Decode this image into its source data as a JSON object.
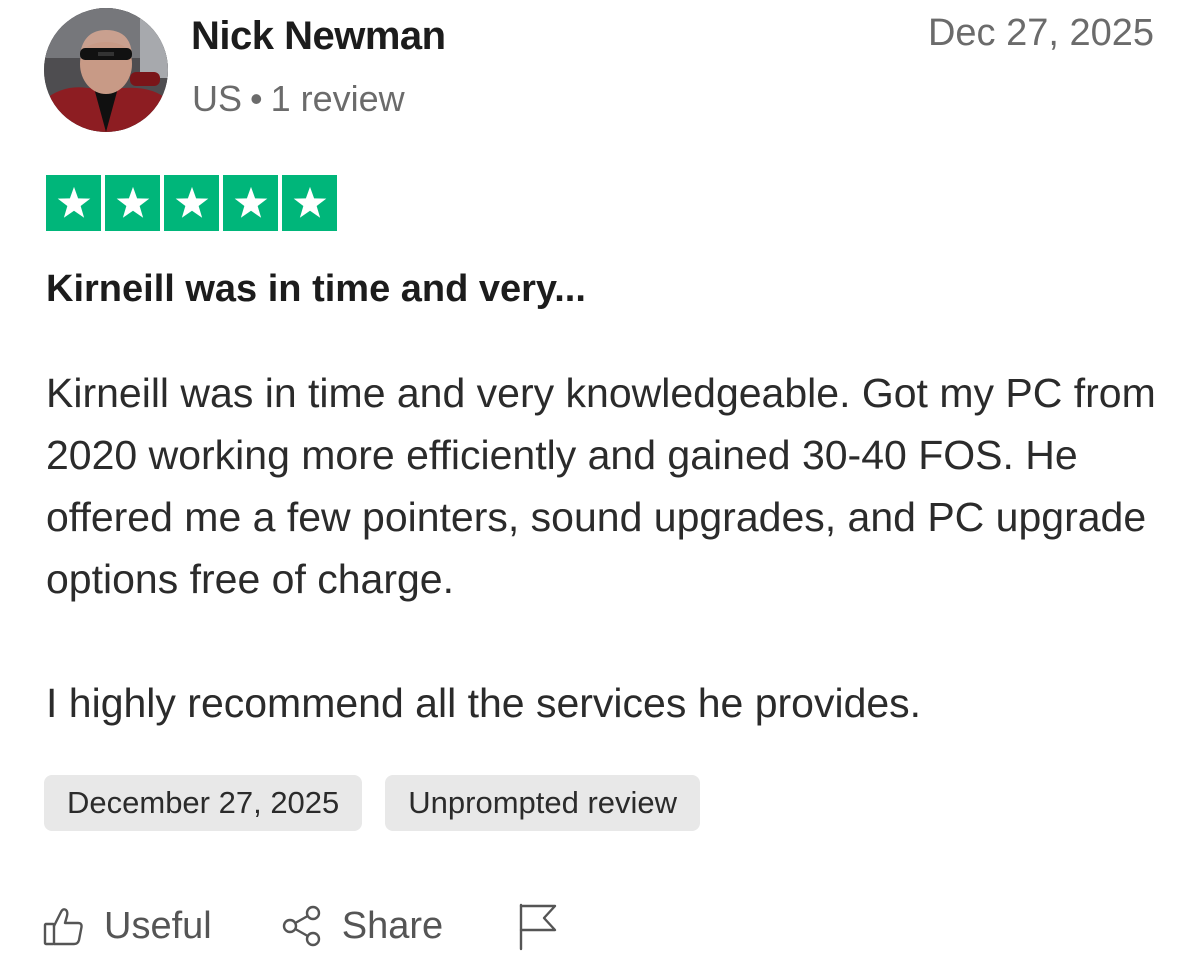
{
  "reviewer": {
    "name": "Nick Newman",
    "country": "US",
    "separator": "•",
    "review_count": "1 review",
    "avatar_icon": "user-photo"
  },
  "review": {
    "date_short": "Dec 27, 2025",
    "rating": 5,
    "rating_max": 5,
    "star_color": "#00b67a",
    "title": "Kirneill was in time and very...",
    "body_paragraphs": [
      "Kirneill was in time and very knowledgeable. Got my PC from 2020 working more efficiently and gained 30-40 FOS. He offered me a few pointers, sound upgrades, and PC upgrade options free of charge.",
      "I highly recommend all the services he provides."
    ],
    "tags": {
      "date_long": "December 27, 2025",
      "source": "Unprompted review"
    }
  },
  "actions": {
    "useful_label": "Useful",
    "useful_icon": "thumbs-up-icon",
    "share_label": "Share",
    "share_icon": "share-icon",
    "flag_icon": "flag-icon"
  }
}
